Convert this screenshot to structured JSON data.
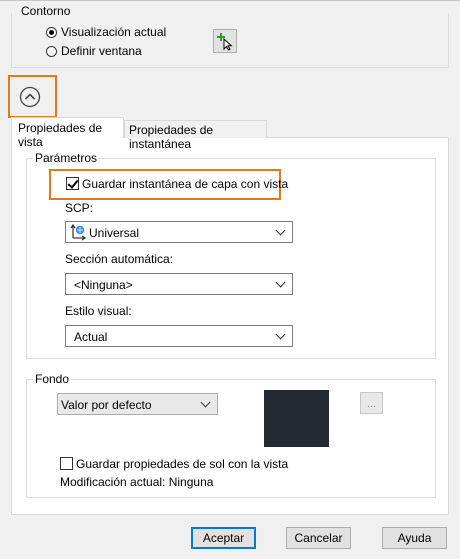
{
  "contorno": {
    "title": "Contorno",
    "options": [
      "Visualización actual",
      "Definir ventana"
    ],
    "selected_index": 0
  },
  "tabs": [
    "Propiedades de vista",
    "Propiedades de instantánea"
  ],
  "parametros": {
    "title": "Parámetros",
    "save_layer_snapshot_label": "Guardar instantánea de capa con vista",
    "save_layer_snapshot_checked": true,
    "scp_label": "SCP:",
    "scp_value": "Universal",
    "section_label": "Sección automática:",
    "section_value": "<Ninguna>",
    "visual_style_label": "Estilo visual:",
    "visual_style_value": "Actual"
  },
  "fondo": {
    "title": "Fondo",
    "background_value": "Valor por defecto",
    "preview_color": "#232a33",
    "browse_label": "...",
    "save_sun_label": "Guardar propiedades de sol con la vista",
    "save_sun_checked": false,
    "current_modification": "Modificación actual: Ninguna"
  },
  "buttons": {
    "ok": "Aceptar",
    "cancel": "Cancelar",
    "help": "Ayuda"
  },
  "colors": {
    "highlight": "#e07b1a",
    "accent": "#0078d7"
  }
}
